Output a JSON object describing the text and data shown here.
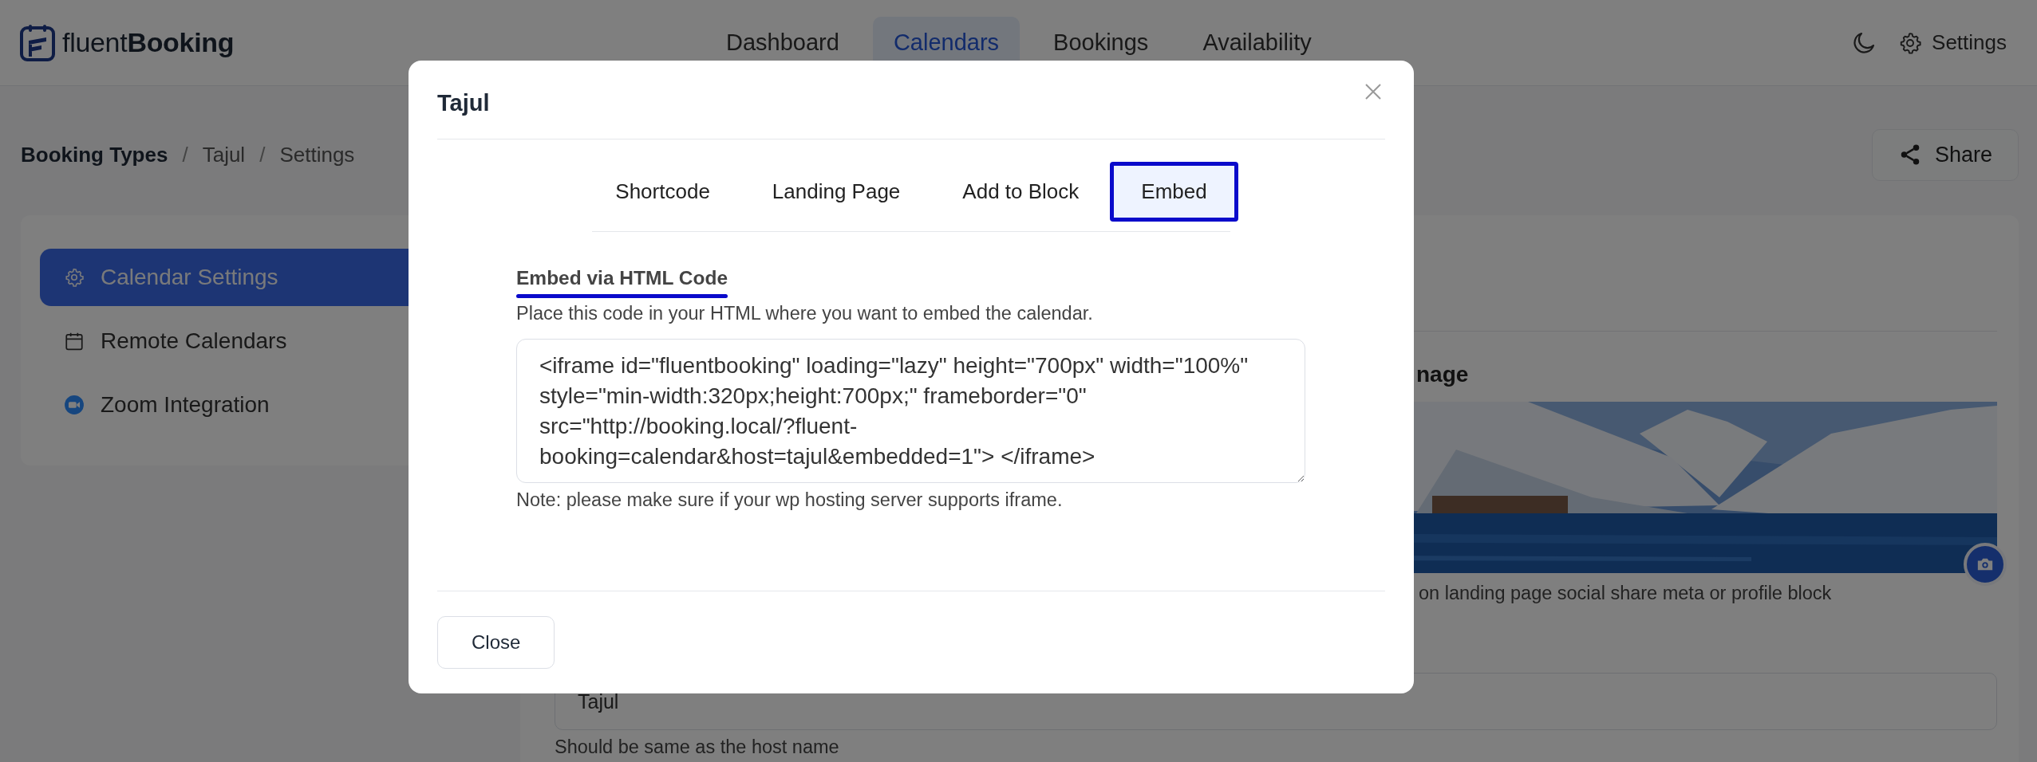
{
  "header": {
    "logo": "fluent**Booking**",
    "nav": [
      {
        "label": "Dashboard",
        "selected": false
      },
      {
        "label": "Calendars",
        "selected": true
      },
      {
        "label": "Bookings",
        "selected": false
      },
      {
        "label": "Availability",
        "selected": false
      }
    ],
    "settings_label": "Settings"
  },
  "breadcrumb": [
    {
      "label": "Booking Types",
      "kind": "root"
    },
    {
      "label": "/",
      "kind": "separator"
    },
    {
      "label": "Tajul",
      "kind": "link"
    },
    {
      "label": "/",
      "kind": "separator"
    },
    {
      "label": "Settings",
      "kind": "link"
    }
  ],
  "share_button": "Share",
  "sidebar": [
    {
      "label": "Calendar Settings",
      "selected": true
    },
    {
      "label": "Remote Calendars",
      "selected": false
    },
    {
      "label": "Zoom Integration",
      "selected": false
    }
  ],
  "form": {
    "section_heading": "nage",
    "image_hint": "on landing page social share meta or profile block",
    "name_field": {
      "value": "Tajul"
    },
    "name_hint": "Should be same as the host name"
  },
  "modal": {
    "title": "Tajul",
    "tabs": [
      {
        "label": "Shortcode",
        "selected": false
      },
      {
        "label": "Landing Page",
        "selected": false
      },
      {
        "label": "Add to Block",
        "selected": false
      },
      {
        "label": "Embed",
        "selected": true
      }
    ],
    "section_title": "Embed via HTML Code",
    "description": "Place this code in your HTML where you want to embed the calendar.",
    "code": "<iframe id=\"fluentbooking\" loading=\"lazy\" height=\"700px\" width=\"100%\" style=\"min-width:320px;height:700px;\" frameborder=\"0\" src=\"http://booking.local/?fluent-booking=calendar&host=tajul&embedded=1\"> </iframe>",
    "note": "Note: please make sure if your wp hosting server supports iframe.",
    "close_button": "Close"
  }
}
